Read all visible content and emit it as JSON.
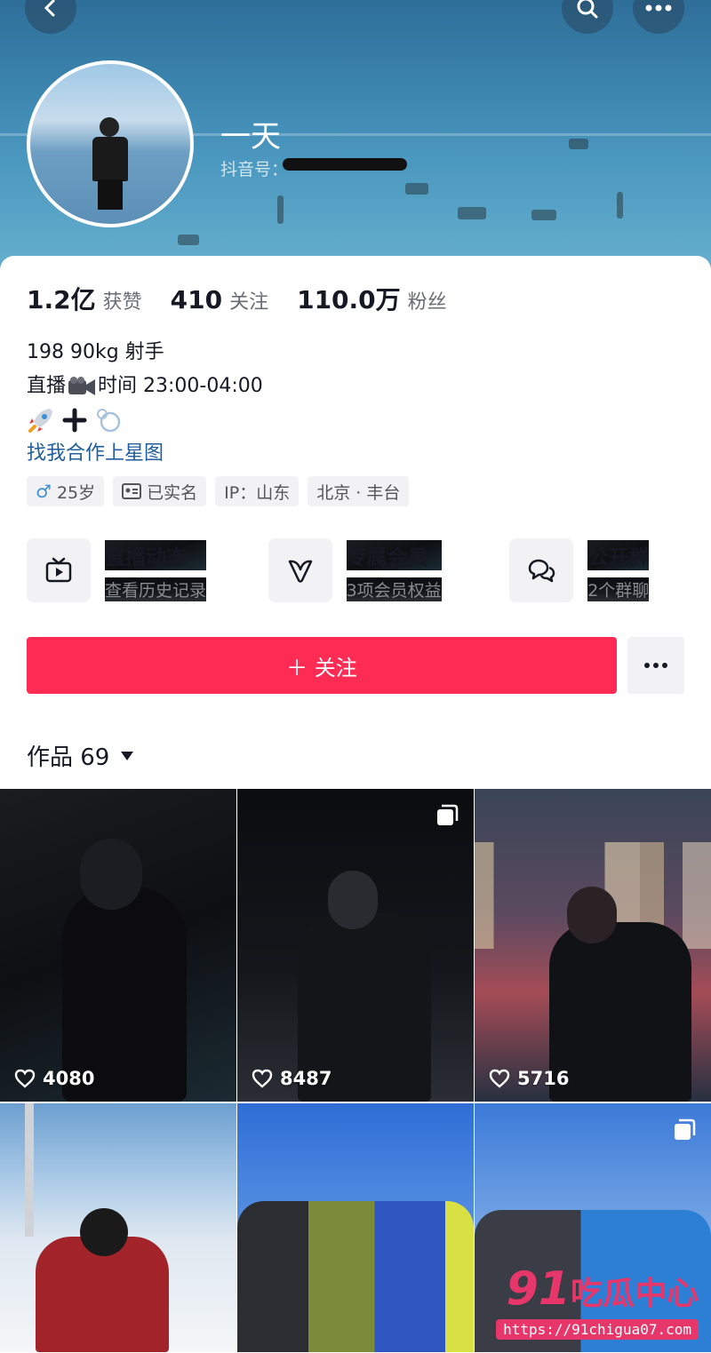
{
  "header": {
    "display_name": "一天",
    "douyin_id_label": "抖音号："
  },
  "stats": [
    {
      "value": "1.2亿",
      "label": "获赞"
    },
    {
      "value": "410",
      "label": "关注"
    },
    {
      "value": "110.0万",
      "label": "粉丝"
    }
  ],
  "bio": {
    "line1": "198 90kg 射手",
    "line2_prefix": "直播",
    "line2_suffix": "时间 23:00-04:00",
    "link": "找我合作上星图"
  },
  "tags": {
    "age": "25岁",
    "verified": "已实名",
    "ip": "IP：山东",
    "location": "北京 · 丰台"
  },
  "features": [
    {
      "title": "直播动态",
      "subtitle": "查看历史记录",
      "icon": "live-tv-icon"
    },
    {
      "title": "专属会员",
      "subtitle": "3项会员权益",
      "icon": "member-v-icon"
    },
    {
      "title": "公开群",
      "subtitle": "2个群聊",
      "icon": "group-chat-icon"
    }
  ],
  "actions": {
    "follow_label": "＋ 关注"
  },
  "works": {
    "tab_label": "作品 69"
  },
  "posts": [
    {
      "likes": "4080",
      "multi_image": false
    },
    {
      "likes": "8487",
      "multi_image": true
    },
    {
      "likes": "5716",
      "multi_image": false
    },
    {
      "likes": "",
      "multi_image": false
    },
    {
      "likes": "",
      "multi_image": false
    },
    {
      "likes": "",
      "multi_image": true
    }
  ],
  "watermark": {
    "logo_number": "91",
    "logo_text": "吃瓜中心",
    "url": "https://91chigua07.com"
  },
  "colors": {
    "accent": "#fe2c55",
    "link": "#1f5d9c",
    "watermark": "#e6366a"
  }
}
